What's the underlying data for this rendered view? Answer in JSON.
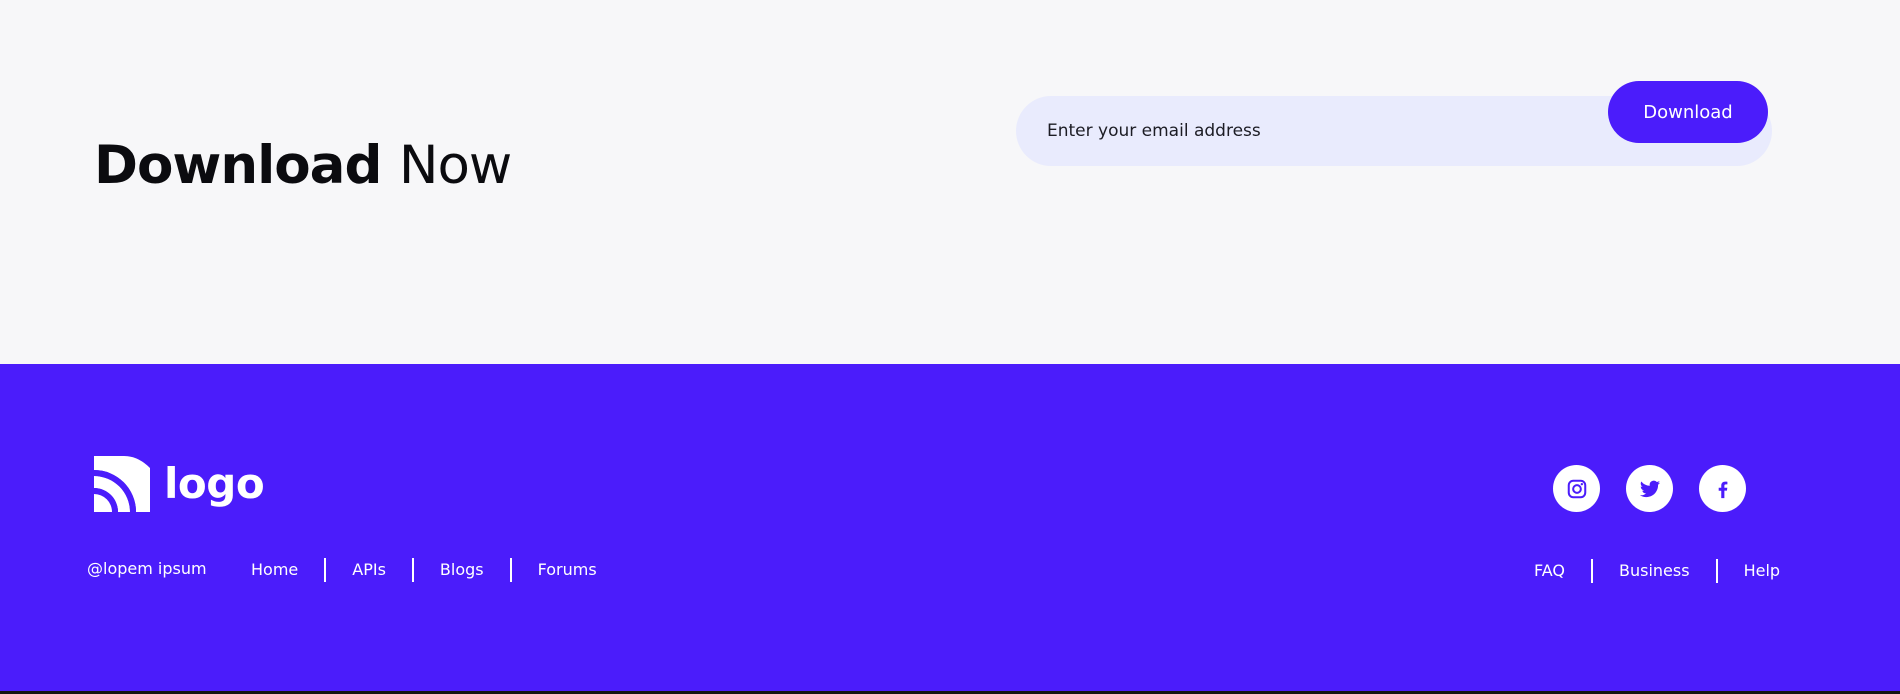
{
  "download": {
    "title_strong": "Download",
    "title_light": "Now",
    "email_placeholder": "Enter your email address",
    "button_label": "Download"
  },
  "footer": {
    "logo_text": "logo",
    "copyright": "@lopem ipsum",
    "nav_left": [
      "Home",
      "APIs",
      "Blogs",
      "Forums"
    ],
    "nav_right": [
      "FAQ",
      "Business",
      "Help"
    ],
    "social_icons": [
      "instagram-icon",
      "twitter-icon",
      "facebook-icon"
    ]
  },
  "colors": {
    "accent": "#4b1cfb",
    "background": "#f7f7f9",
    "input_background": "#e9ebfd"
  }
}
